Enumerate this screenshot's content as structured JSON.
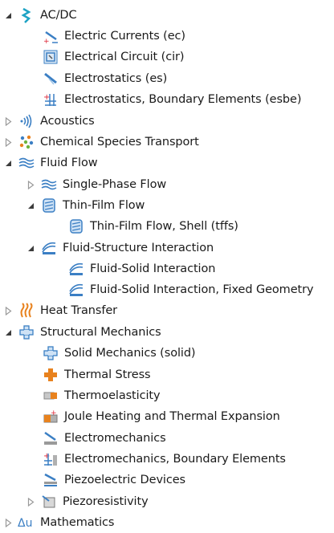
{
  "tree": {
    "items": [
      {
        "label": "AC/DC",
        "icon": "acdc-icon",
        "expander": "expanded"
      },
      {
        "label": "Electric Currents (ec)",
        "icon": "electric-currents-icon",
        "expander": "none"
      },
      {
        "label": "Electrical Circuit (cir)",
        "icon": "electrical-circuit-icon",
        "expander": "none"
      },
      {
        "label": "Electrostatics (es)",
        "icon": "electrostatics-icon",
        "expander": "none"
      },
      {
        "label": "Electrostatics, Boundary Elements (esbe)",
        "icon": "boundary-elements-icon",
        "expander": "none"
      },
      {
        "label": "Acoustics",
        "icon": "acoustics-icon",
        "expander": "collapsed"
      },
      {
        "label": "Chemical Species Transport",
        "icon": "chemical-species-icon",
        "expander": "collapsed"
      },
      {
        "label": "Fluid Flow",
        "icon": "fluid-flow-icon",
        "expander": "expanded"
      },
      {
        "label": "Single-Phase Flow",
        "icon": "single-phase-flow-icon",
        "expander": "collapsed"
      },
      {
        "label": "Thin-Film Flow",
        "icon": "thin-film-flow-icon",
        "expander": "expanded"
      },
      {
        "label": "Thin-Film Flow, Shell (tffs)",
        "icon": "thin-film-shell-icon",
        "expander": "none"
      },
      {
        "label": "Fluid-Structure Interaction",
        "icon": "fluid-structure-icon",
        "expander": "expanded"
      },
      {
        "label": "Fluid-Solid Interaction",
        "icon": "fluid-solid-icon",
        "expander": "none"
      },
      {
        "label": "Fluid-Solid Interaction, Fixed Geometry",
        "icon": "fluid-solid-fixed-icon",
        "expander": "none"
      },
      {
        "label": "Heat Transfer",
        "icon": "heat-transfer-icon",
        "expander": "collapsed"
      },
      {
        "label": "Structural Mechanics",
        "icon": "structural-mechanics-icon",
        "expander": "expanded"
      },
      {
        "label": "Solid Mechanics (solid)",
        "icon": "solid-mechanics-icon",
        "expander": "none"
      },
      {
        "label": "Thermal Stress",
        "icon": "thermal-stress-icon",
        "expander": "none"
      },
      {
        "label": "Thermoelasticity",
        "icon": "thermoelasticity-icon",
        "expander": "none"
      },
      {
        "label": "Joule Heating and Thermal Expansion",
        "icon": "joule-heating-icon",
        "expander": "none"
      },
      {
        "label": "Electromechanics",
        "icon": "electromechanics-icon",
        "expander": "none"
      },
      {
        "label": "Electromechanics, Boundary Elements",
        "icon": "electromechanics-be-icon",
        "expander": "none"
      },
      {
        "label": "Piezoelectric Devices",
        "icon": "piezoelectric-icon",
        "expander": "none"
      },
      {
        "label": "Piezoresistivity",
        "icon": "piezoresistivity-icon",
        "expander": "collapsed"
      },
      {
        "label": "Mathematics",
        "icon": "mathematics-icon",
        "expander": "collapsed"
      }
    ]
  },
  "colors": {
    "text": "#1a1a1a",
    "expander": "#3c3c3c",
    "expander_collapsed": "#9a9a9a",
    "blue_icon": "#3b7fc4",
    "orange_icon": "#e8821e",
    "teal_icon": "#1fa3c4"
  }
}
